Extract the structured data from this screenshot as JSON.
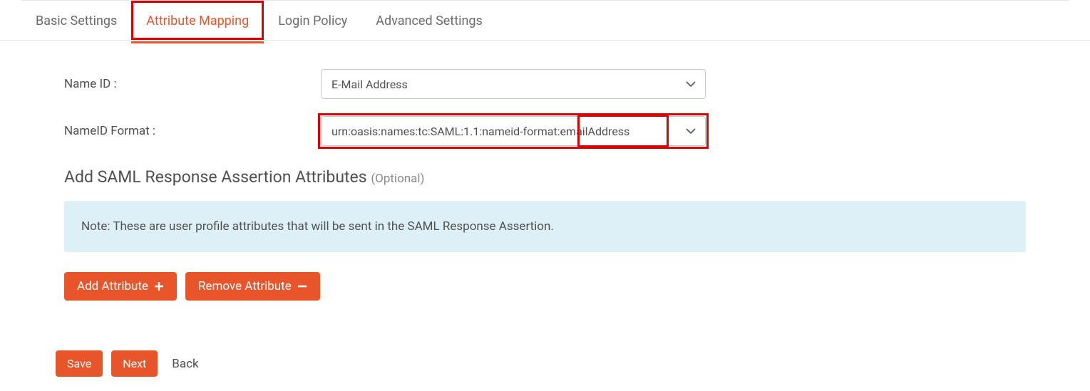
{
  "tabs": {
    "basic": "Basic Settings",
    "attribute": "Attribute Mapping",
    "login": "Login Policy",
    "advanced": "Advanced Settings"
  },
  "form": {
    "nameid_label": "Name ID :",
    "nameid_value": "E-Mail Address",
    "nameid_format_label": "NameID Format :",
    "nameid_format_value": "urn:oasis:names:tc:SAML:1.1:nameid-format:emailAddress"
  },
  "section": {
    "heading": "Add SAML Response Assertion Attributes ",
    "optional": "(Optional)",
    "note": "Note: These are user profile attributes that will be sent in the SAML Response Assertion."
  },
  "buttons": {
    "add_attribute": "Add Attribute",
    "remove_attribute": "Remove Attribute",
    "save": "Save",
    "next": "Next",
    "back": "Back"
  }
}
